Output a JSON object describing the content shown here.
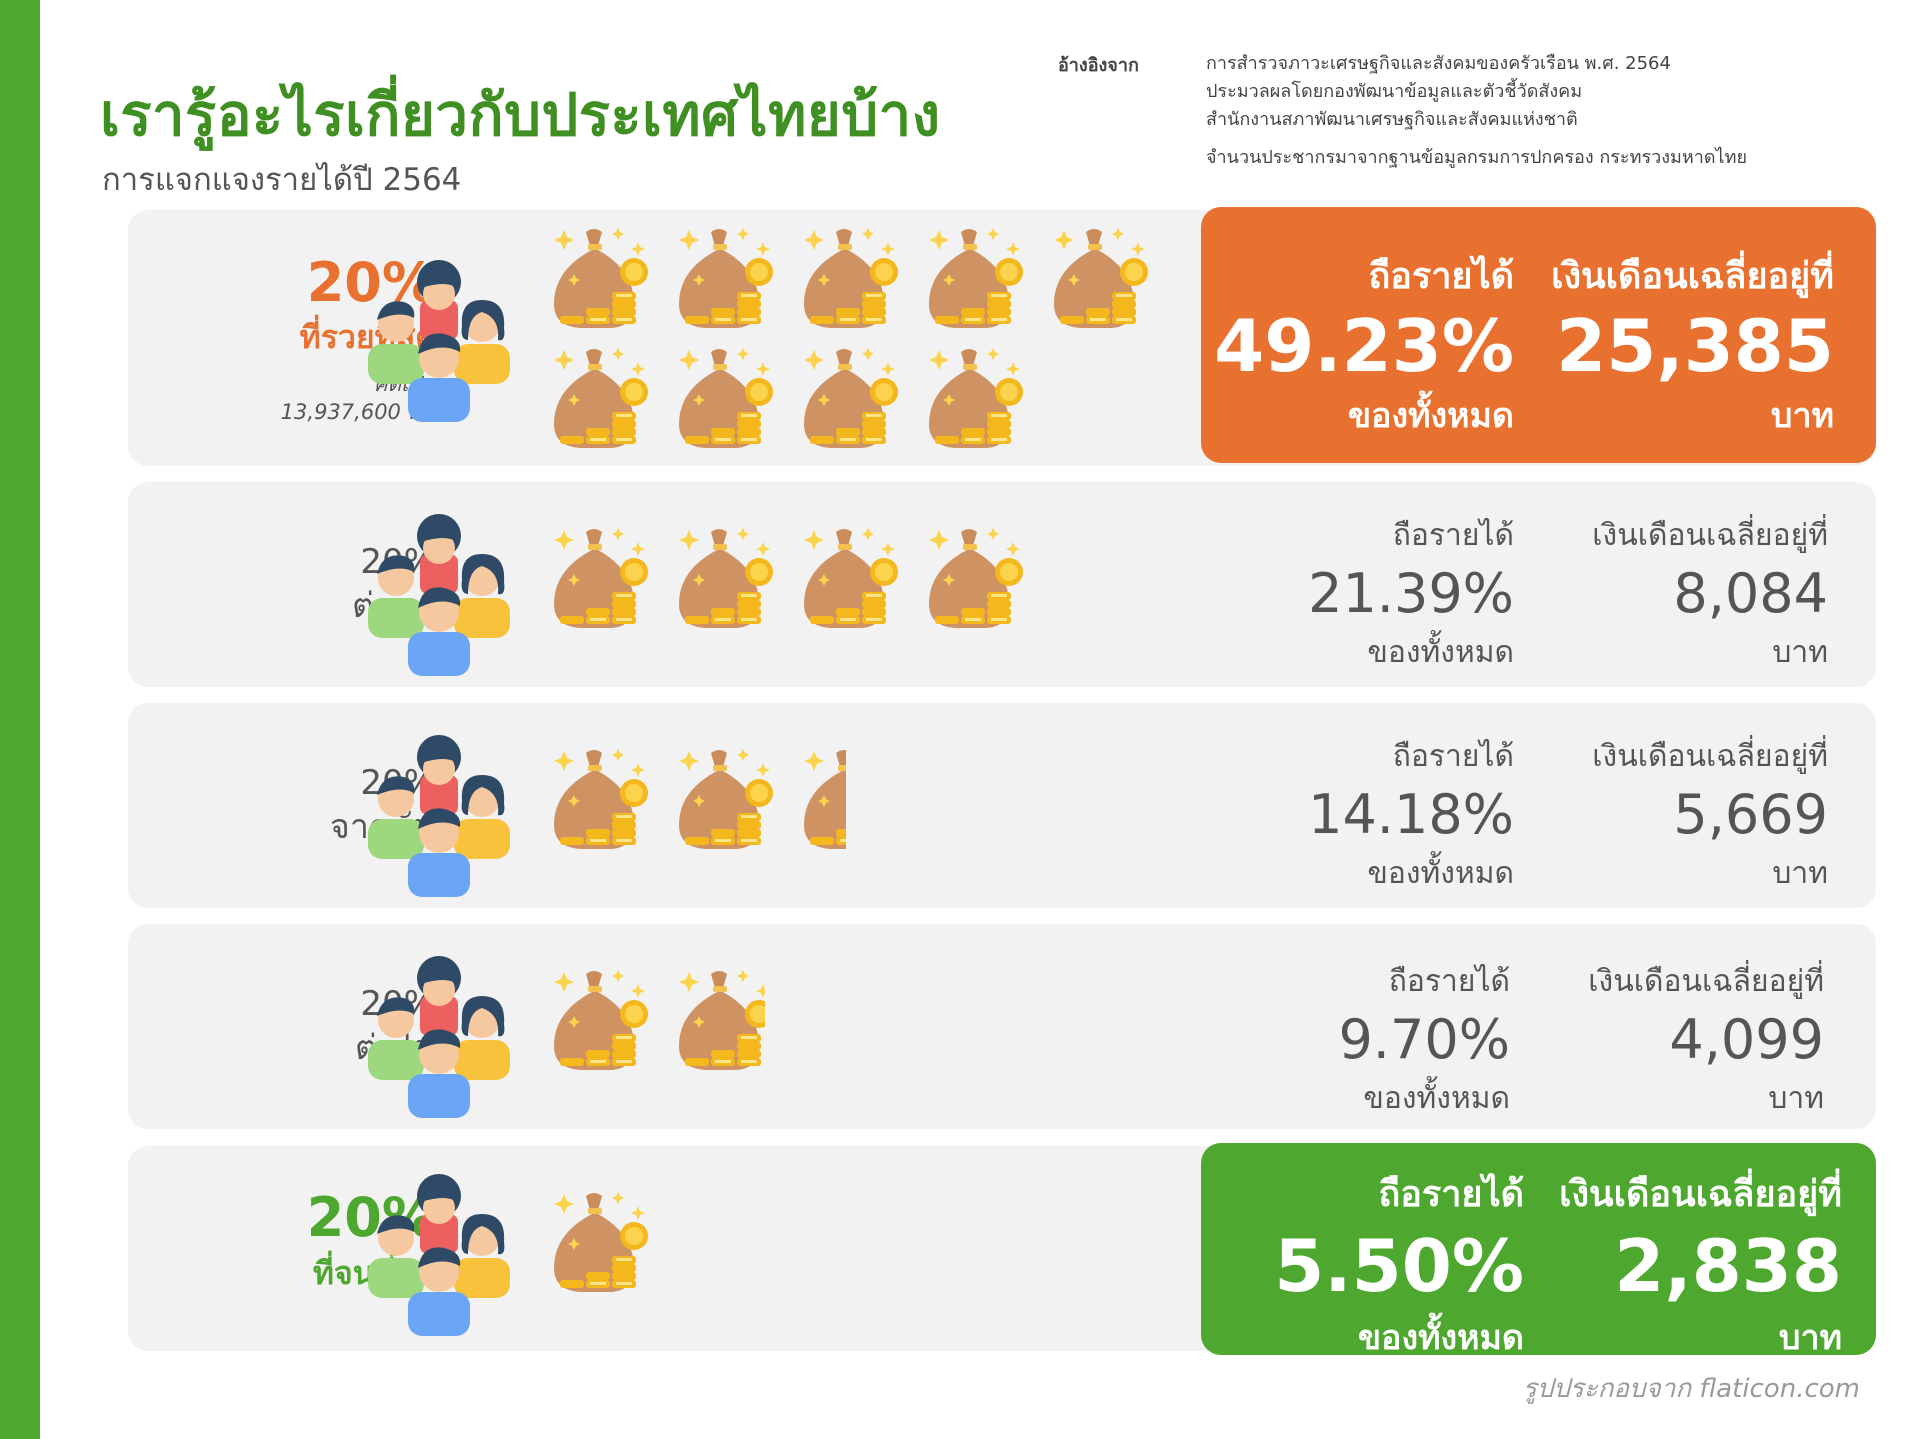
{
  "title": "เรารู้อะไรเกี่ยวกับประเทศไทยบ้าง",
  "subtitle": "การแจกแจงรายได้ปี 2564",
  "reference": {
    "label": "อ้างอิงจาก",
    "lines": [
      "การสำรวจภาวะเศรษฐกิจและสังคมของครัวเรือน พ.ศ. 2564",
      "ประมวลผลโดยกองพัฒนาข้อมูลและตัวชี้วัดสังคม",
      "สำนักงานสภาพัฒนาเศรษฐกิจและสังคมแห่งชาติ"
    ],
    "population_note": "จำนวนประชากรมาจากฐานข้อมูลกรมการปกครอง กระทรวงมหาดไทย"
  },
  "colors": {
    "accent_green": "#4ea72e",
    "title_green": "#3f8f22",
    "highlight_orange": "#e87130",
    "row_bg": "#f2f2f2"
  },
  "groups": [
    {
      "pct": "20%",
      "name": "ที่รวยที่สุด",
      "note_line1": "คิดเป็น",
      "note_line2": "13,937,600 คน",
      "income_label": "ถือรายได้",
      "income_share": "49.23%",
      "income_unit": "ของทั้งหมด",
      "salary_label": "เงินเดือนเฉลี่ยอยู่ที่",
      "salary": "25,385",
      "salary_unit": "บาท",
      "money_bag_icons": 9
    },
    {
      "pct": "20%",
      "name": "ต่อมา",
      "income_label": "ถือรายได้",
      "income_share": "21.39%",
      "income_unit": "ของทั้งหมด",
      "salary_label": "เงินเดือนเฉลี่ยอยู่ที่",
      "salary": "8,084",
      "salary_unit": "บาท",
      "money_bag_icons": 4
    },
    {
      "pct": "20%",
      "name": "จากนั้น",
      "income_label": "ถือรายได้",
      "income_share": "14.18%",
      "income_unit": "ของทั้งหมด",
      "salary_label": "เงินเดือนเฉลี่ยอยู่ที่",
      "salary": "5,669",
      "salary_unit": "บาท",
      "money_bag_icons": 2.45
    },
    {
      "pct": "20%",
      "name": "ต่อไป",
      "income_label": "ถือรายได้",
      "income_share": "9.70%",
      "income_unit": "ของทั้งหมด",
      "salary_label": "เงินเดือนเฉลี่ยอยู่ที่",
      "salary": "4,099",
      "salary_unit": "บาท",
      "money_bag_icons": 1.85
    },
    {
      "pct": "20%",
      "name": "ที่จนที่สุด",
      "income_label": "ถือรายได้",
      "income_share": "5.50%",
      "income_unit": "ของทั้งหมด",
      "salary_label": "เงินเดือนเฉลี่ยอยู่ที่",
      "salary": "2,838",
      "salary_unit": "บาท",
      "money_bag_icons": 1
    }
  ],
  "icons": {
    "people": "people-group-icon",
    "money": "money-bag-icon"
  },
  "credit": "รูปประกอบจาก flaticon.com"
}
